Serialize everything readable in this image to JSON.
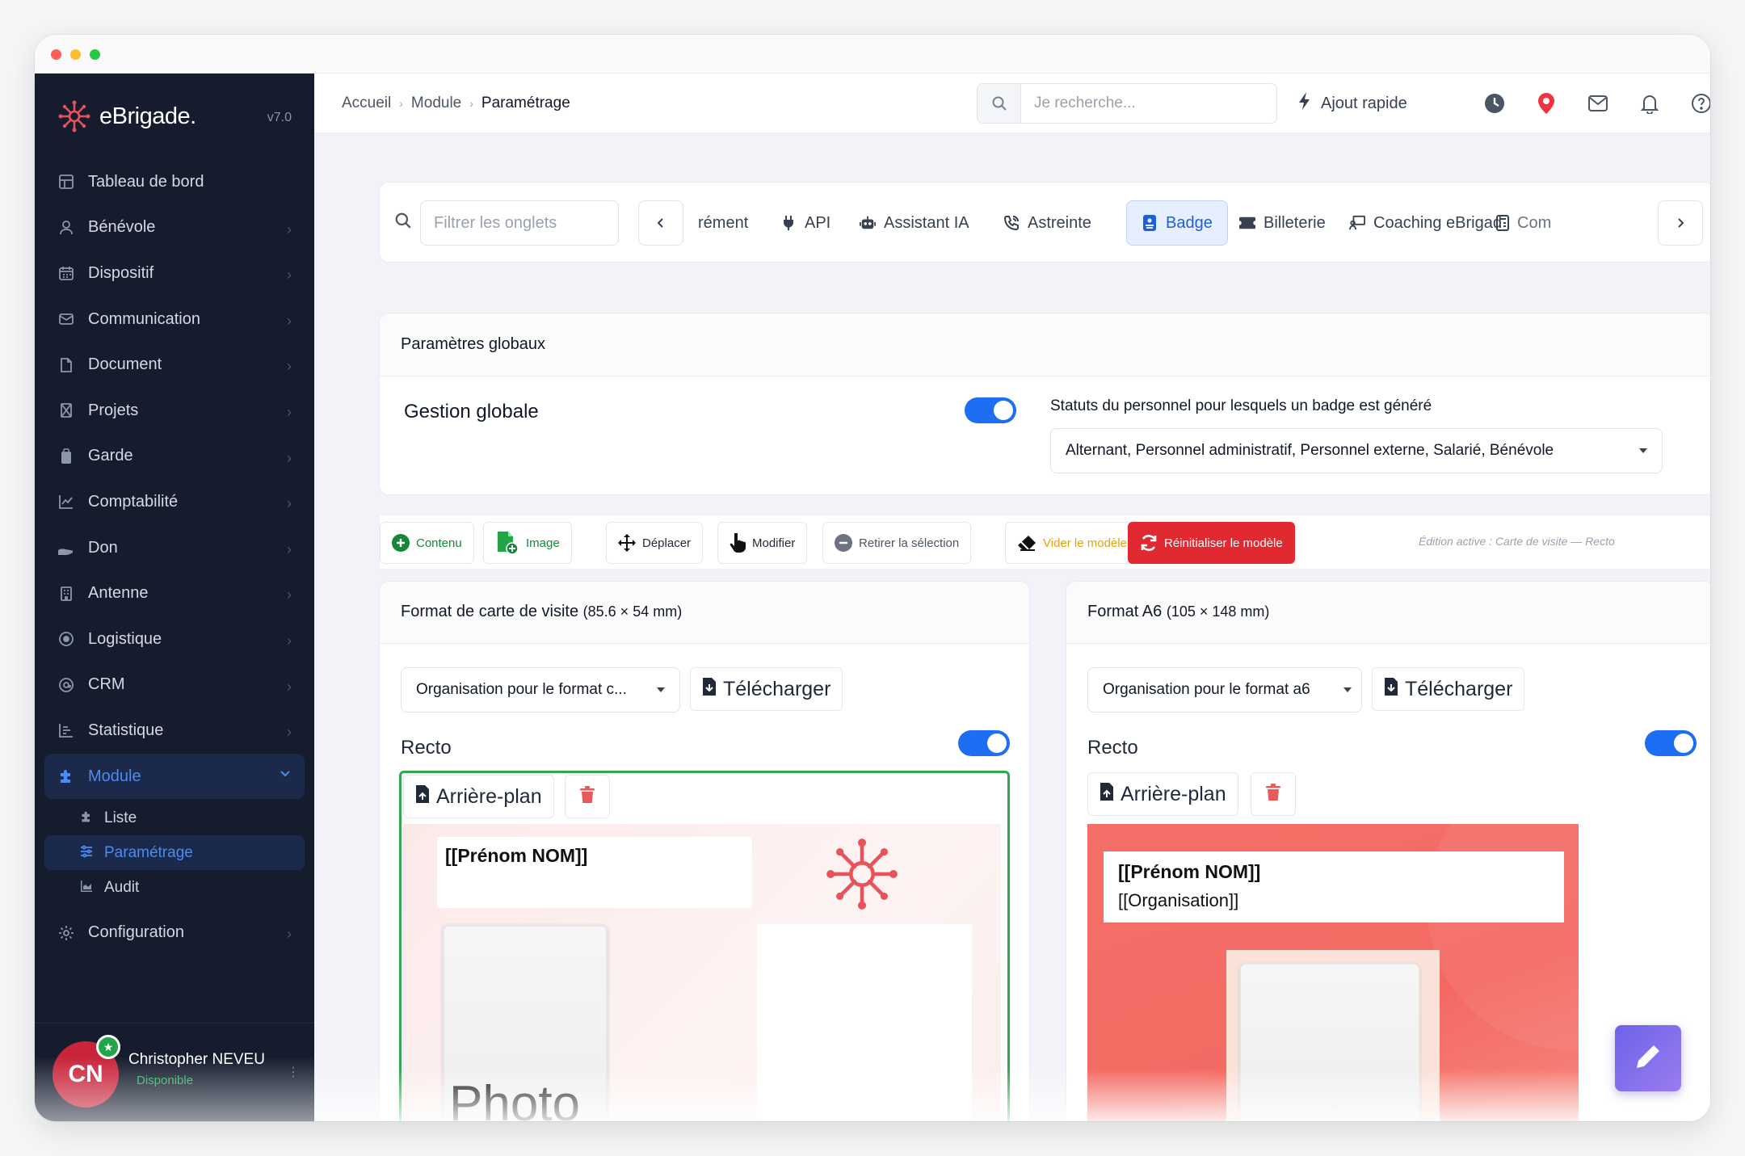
{
  "window": {
    "traffic_lights": [
      "close",
      "minimize",
      "maximize"
    ]
  },
  "brand": {
    "name": "eBrigade.",
    "version": "v7.0",
    "color": "#e8525a"
  },
  "sidebar": {
    "items": [
      {
        "label": "Tableau de bord",
        "icon": "dashboard-icon"
      },
      {
        "label": "Bénévole",
        "icon": "user-icon"
      },
      {
        "label": "Dispositif",
        "icon": "calendar-icon"
      },
      {
        "label": "Communication",
        "icon": "mail-icon"
      },
      {
        "label": "Document",
        "icon": "file-icon"
      },
      {
        "label": "Projets",
        "icon": "project-icon"
      },
      {
        "label": "Garde",
        "icon": "clipboard-icon"
      },
      {
        "label": "Comptabilité",
        "icon": "chart-icon"
      },
      {
        "label": "Don",
        "icon": "hand-icon"
      },
      {
        "label": "Antenne",
        "icon": "building-icon"
      },
      {
        "label": "Logistique",
        "icon": "target-icon"
      },
      {
        "label": "CRM",
        "icon": "at-icon"
      },
      {
        "label": "Statistique",
        "icon": "bars-icon"
      },
      {
        "label": "Module",
        "icon": "puzzle-icon"
      }
    ],
    "module_sub": [
      {
        "label": "Liste",
        "icon": "puzzle-icon"
      },
      {
        "label": "Paramétrage",
        "icon": "sliders-icon"
      },
      {
        "label": "Audit",
        "icon": "area-chart-icon"
      }
    ],
    "config": {
      "label": "Configuration",
      "icon": "gear-icon"
    },
    "user": {
      "initials": "CN",
      "name": "Christopher NEVEU",
      "status": "Disponible"
    }
  },
  "topbar": {
    "breadcrumb": [
      "Accueil",
      "Module",
      "Paramétrage"
    ],
    "search_placeholder": "Je recherche...",
    "quick_add": "Ajout rapide"
  },
  "tabs": {
    "filter_placeholder": "Filtrer les onglets",
    "items": [
      "rément",
      "API",
      "Assistant IA",
      "Astreinte",
      "Badge",
      "Billeterie",
      "Coaching eBrigade",
      "Comp"
    ],
    "active": "Badge"
  },
  "global": {
    "title": "Paramètres globaux",
    "management_label": "Gestion globale",
    "statuses_label": "Statuts du personnel pour lesquels un badge est généré",
    "statuses_value": "Alternant, Personnel administratif, Personnel externe, Salarié, Bénévole"
  },
  "toolbar": {
    "content": "Contenu",
    "image": "Image",
    "move": "Déplacer",
    "edit": "Modifier",
    "remove_selection": "Retirer la sélection",
    "clear_model": "Vider le modèle",
    "reset_model": "Réinitialiser le modèle",
    "edit_note": "Édition active : Carte de visite — Recto"
  },
  "card_format": {
    "title": "Format de carte de visite",
    "dims": "(85.6 × 54 mm)",
    "org_select": "Organisation pour le format c...",
    "download": "Télécharger",
    "recto": "Recto",
    "background": "Arrière-plan",
    "name_placeholder": "[[Prénom NOM]]",
    "photo_label": "Photo"
  },
  "a6_format": {
    "title": "Format A6",
    "dims": "(105 × 148 mm)",
    "org_select": "Organisation pour le format a6",
    "download": "Télécharger",
    "recto": "Recto",
    "background": "Arrière-plan",
    "name_placeholder": "[[Prénom NOM]]",
    "org_placeholder": "[[Organisation]]"
  },
  "colors": {
    "sidebar_bg": "#141c2e",
    "accent_blue": "#1d6ef3",
    "danger_red": "#e02930",
    "success_green": "#22a447",
    "badge_bg": "#f26d6a"
  }
}
